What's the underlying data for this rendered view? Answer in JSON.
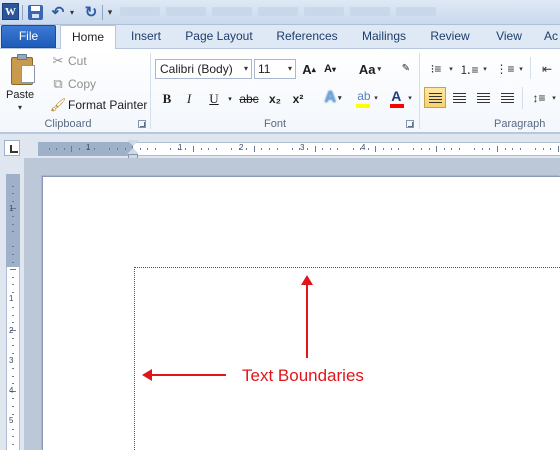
{
  "title_bar": {
    "app_icon_letter": "W",
    "undo_icon": "undo-icon",
    "redo_icon": "redo-icon",
    "save_icon": "save-icon",
    "dropdown_glyph": "▾"
  },
  "tabs": {
    "file": "File",
    "home": "Home",
    "insert": "Insert",
    "page_layout": "Page Layout",
    "references": "References",
    "mailings": "Mailings",
    "review": "Review",
    "view": "View",
    "addins": "Ac"
  },
  "clipboard": {
    "paste": "Paste",
    "cut": "Cut",
    "copy": "Copy",
    "format_painter": "Format Painter",
    "group_label": "Clipboard"
  },
  "font": {
    "font_name": "Calibri (Body)",
    "font_size": "11",
    "grow_label": "A",
    "shrink_label": "A",
    "change_case_label": "Aa",
    "bold": "B",
    "italic": "I",
    "underline": "U",
    "strikethrough": "abc",
    "subscript": "x₂",
    "superscript": "x²",
    "text_effects": "A",
    "font_color_letter": "A",
    "group_label": "Font",
    "highlight_color": "#ffff00",
    "font_color": "#ff0000"
  },
  "paragraph": {
    "group_label": "Paragraph"
  },
  "ruler": {
    "horizontal_numbers": [
      "1",
      "1",
      "2",
      "3",
      "4"
    ],
    "vertical_numbers": [
      "1",
      "1",
      "2",
      "3",
      "4",
      "5"
    ]
  },
  "annotation": {
    "label": "Text Boundaries",
    "color": "#e0161a"
  }
}
